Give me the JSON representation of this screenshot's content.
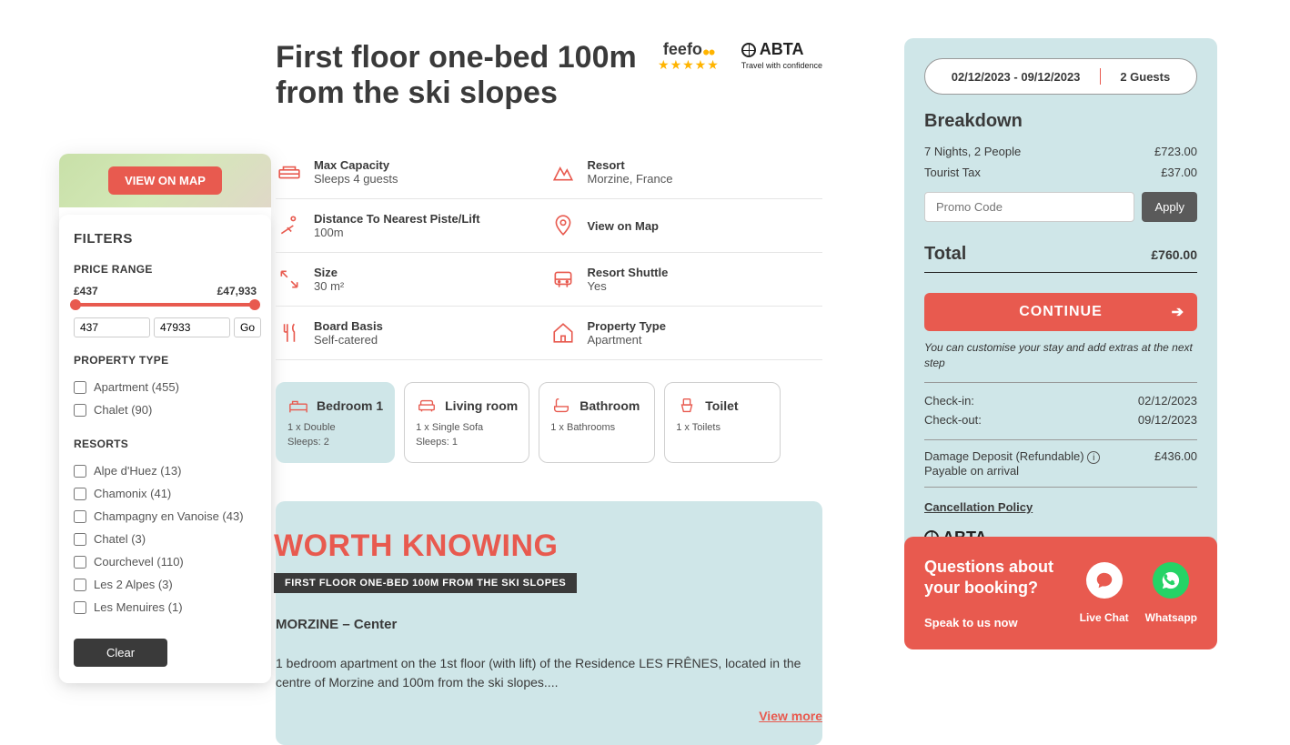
{
  "filter": {
    "map_button": "VIEW ON MAP",
    "title": "FILTERS",
    "price_label": "PRICE RANGE",
    "price_min_display": "£437",
    "price_max_display": "£47,933",
    "price_min": "437",
    "price_max": "47933",
    "go": "Go",
    "property_type_label": "PROPERTY TYPE",
    "property_types": [
      "Apartment (455)",
      "Chalet (90)"
    ],
    "resorts_label": "RESORTS",
    "resorts": [
      "Alpe d'Huez (13)",
      "Chamonix (41)",
      "Champagny en Vanoise (43)",
      "Chatel (3)",
      "Courchevel (110)",
      "Les 2 Alpes (3)",
      "Les Menuires (1)"
    ],
    "clear": "Clear"
  },
  "listing": {
    "title": "First floor one-bed 100m from the ski slopes",
    "feefo": "feefo",
    "abta": "ABTA",
    "abta_sub": "Travel with confidence",
    "info": {
      "capacity_label": "Max Capacity",
      "capacity_value": "Sleeps 4 guests",
      "resort_label": "Resort",
      "resort_value": "Morzine, France",
      "distance_label": "Distance To Nearest Piste/Lift",
      "distance_value": "100m",
      "map_label": "View on Map",
      "size_label": "Size",
      "size_value": "30 m²",
      "shuttle_label": "Resort Shuttle",
      "shuttle_value": "Yes",
      "board_label": "Board Basis",
      "board_value": "Self-catered",
      "ptype_label": "Property Type",
      "ptype_value": "Apartment"
    },
    "rooms": [
      {
        "name": "Bedroom 1",
        "d1": "1 x Double",
        "d2": "Sleeps: 2"
      },
      {
        "name": "Living room",
        "d1": "1 x Single Sofa",
        "d2": "Sleeps: 1"
      },
      {
        "name": "Bathroom",
        "d1": "1 x Bathrooms",
        "d2": ""
      },
      {
        "name": "Toilet",
        "d1": "1 x Toilets",
        "d2": ""
      }
    ],
    "worth": {
      "heading": "WORTH KNOWING",
      "strip": "FIRST FLOOR ONE-BED 100M FROM THE SKI SLOPES",
      "location": "MORZINE – Center",
      "desc": "1 bedroom apartment on the 1st floor (with lift) of the Residence LES FRÊNES, located in the centre of Morzine and 100m from the ski slopes....",
      "view_more": "View more"
    }
  },
  "booking": {
    "dates": "02/12/2023 - 09/12/2023",
    "guests": "2 Guests",
    "breakdown_title": "Breakdown",
    "line1_label": "7 Nights, 2 People",
    "line1_value": "£723.00",
    "line2_label": "Tourist Tax",
    "line2_value": "£37.00",
    "promo_placeholder": "Promo Code",
    "apply": "Apply",
    "total_label": "Total",
    "total_value": "£760.00",
    "continue": "CONTINUE",
    "continue_note": "You can customise your stay and add extras at the next step",
    "checkin_label": "Check-in:",
    "checkin_value": "02/12/2023",
    "checkout_label": "Check-out:",
    "checkout_value": "09/12/2023",
    "deposit_label": "Damage Deposit (Refundable)",
    "deposit_sub": "Payable on arrival",
    "deposit_value": "£436.00",
    "cancel_link": "Cancellation Policy"
  },
  "questions": {
    "title": "Questions about your booking?",
    "sub": "Speak to us now",
    "live_chat": "Live Chat",
    "whatsapp": "Whatsapp"
  }
}
